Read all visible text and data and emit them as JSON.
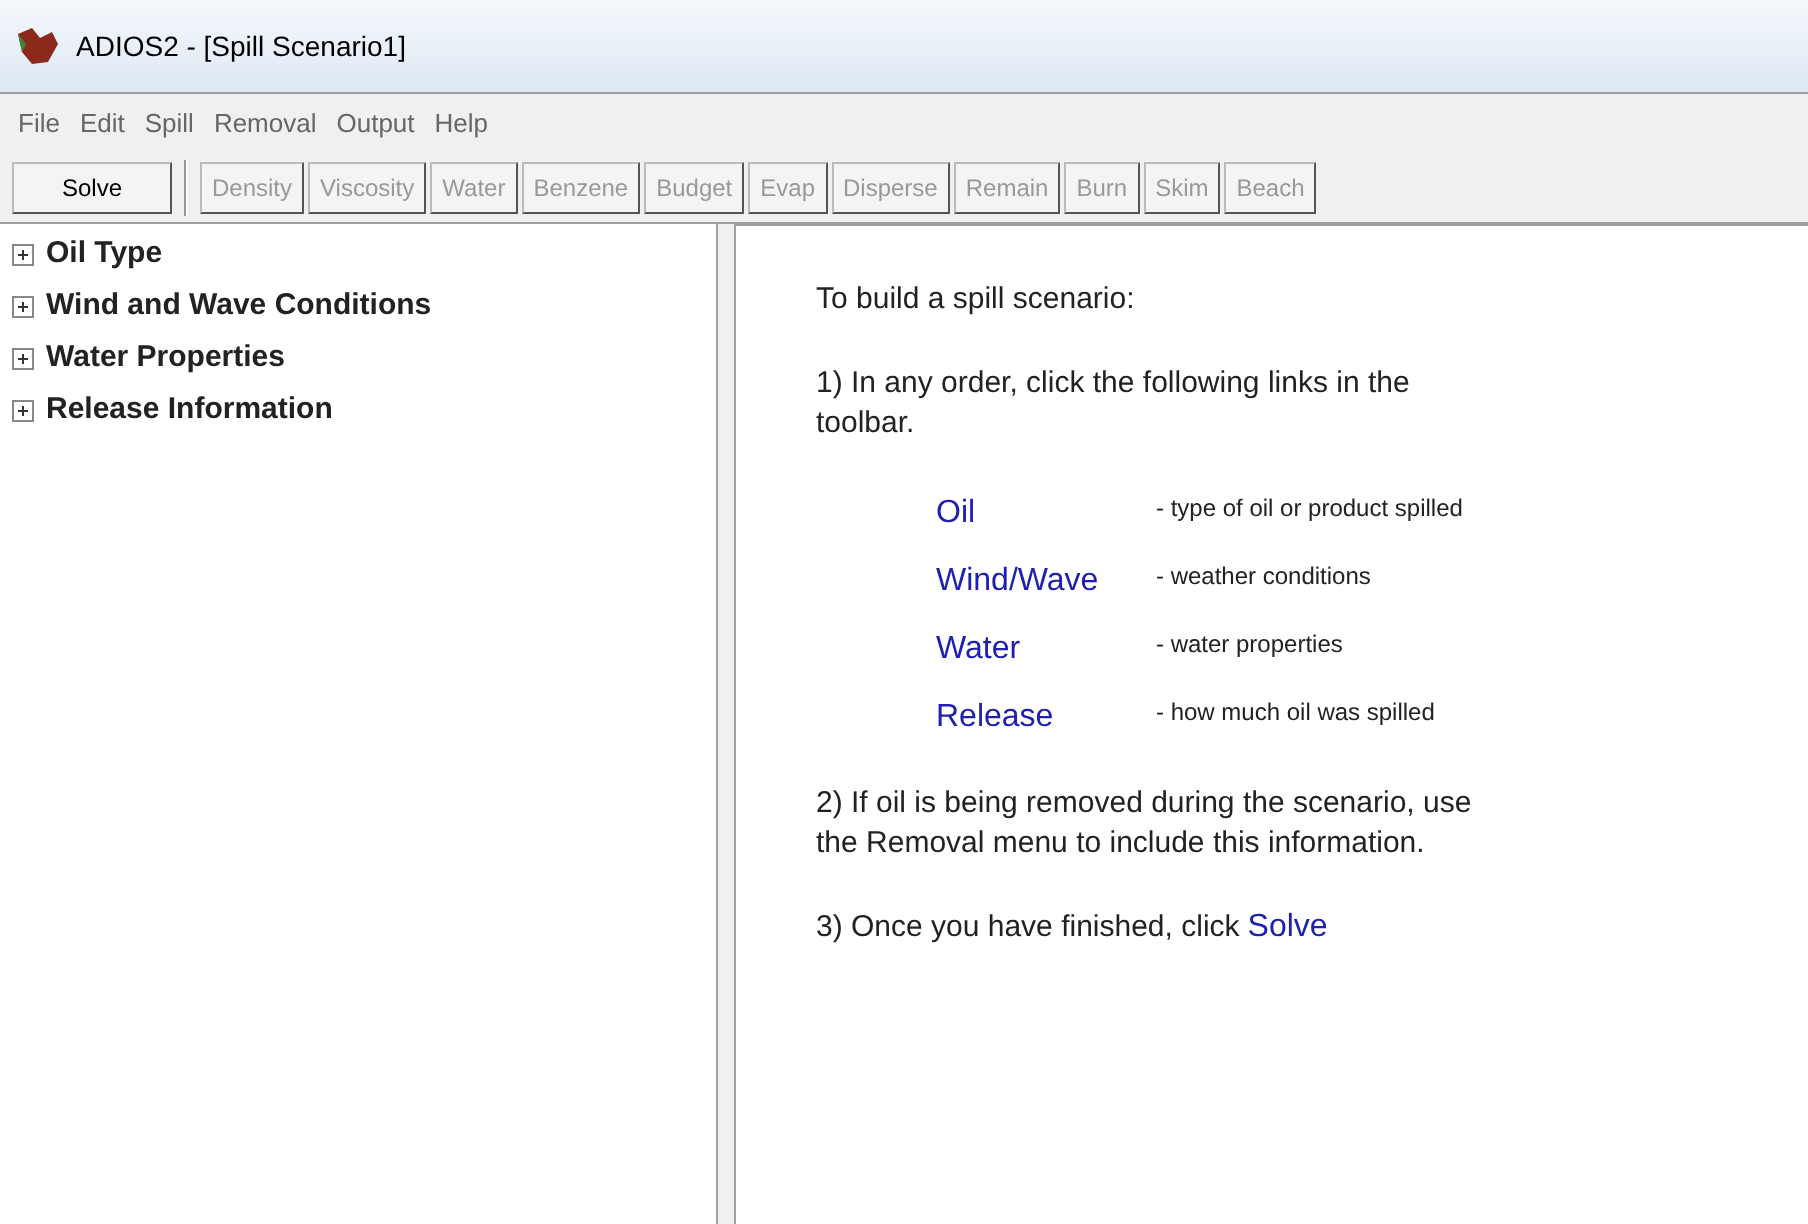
{
  "window": {
    "title": "ADIOS2 - [Spill Scenario1]"
  },
  "menu": [
    "File",
    "Edit",
    "Spill",
    "Removal",
    "Output",
    "Help"
  ],
  "toolbar": [
    {
      "label": "Solve",
      "disabled": false
    },
    {
      "label": "Density",
      "disabled": true
    },
    {
      "label": "Viscosity",
      "disabled": true
    },
    {
      "label": "Water",
      "disabled": true
    },
    {
      "label": "Benzene",
      "disabled": true
    },
    {
      "label": "Budget",
      "disabled": true
    },
    {
      "label": "Evap",
      "disabled": true
    },
    {
      "label": "Disperse",
      "disabled": true
    },
    {
      "label": "Remain",
      "disabled": true
    },
    {
      "label": "Burn",
      "disabled": true
    },
    {
      "label": "Skim",
      "disabled": true
    },
    {
      "label": "Beach",
      "disabled": true
    }
  ],
  "tree": [
    {
      "label": "Oil Type",
      "expanded": false
    },
    {
      "label": "Wind and Wave Conditions",
      "expanded": false
    },
    {
      "label": "Water Properties",
      "expanded": false
    },
    {
      "label": "Release Information",
      "expanded": false
    }
  ],
  "instructions": {
    "heading": "To build a spill scenario:",
    "step_1": "1) In any order, click the following links in the toolbar.",
    "links": [
      {
        "link": "Oil",
        "description": "- type of oil or product spilled"
      },
      {
        "link": "Wind/Wave",
        "description": "- weather conditions"
      },
      {
        "link": "Water",
        "description": "- water properties"
      },
      {
        "link": "Release",
        "description": "- how much oil was spilled"
      }
    ],
    "step_2": "2) If oil is being removed during the scenario, use the Removal menu to include this information.",
    "step_3": "3) Once you have finished, click",
    "step_3_link": "Solve"
  }
}
